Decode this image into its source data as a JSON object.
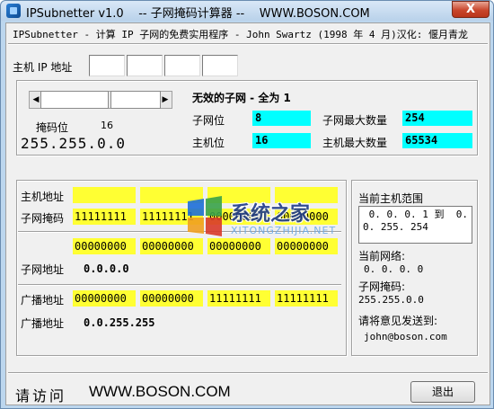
{
  "window": {
    "title": "IPSubnetter v1.0    -- 子网掩码计算器 --    WWW.BOSON.COM",
    "close_label": "X"
  },
  "header": {
    "subtitle": "IPSubnetter - 计算 IP 子网的免费实用程序 - John Swartz (1998 年 4 月)汉化: 偃月青龙"
  },
  "host_ip": {
    "label": "主机 IP 地址",
    "octets": [
      "",
      "",
      "",
      ""
    ]
  },
  "mask": {
    "bits_label": "掩码位",
    "bits_value": "16",
    "dotted": "255.255.0.0"
  },
  "stats": {
    "invalid_text": "无效的子网 - 全为 1",
    "subnet_bits_label": "子网位",
    "subnet_bits_value": "8",
    "max_subnets_label": "子网最大数量",
    "max_subnets_value": "254",
    "host_bits_label": "主机位",
    "host_bits_value": "16",
    "max_hosts_label": "主机最大数量",
    "max_hosts_value": "65534"
  },
  "binary": {
    "host_addr_label": "主机地址",
    "host_addr_bits": [
      "",
      "",
      "",
      ""
    ],
    "subnet_mask_label": "子网掩码",
    "subnet_mask_bits": [
      "11111111",
      "11111111",
      "00000000",
      "00000000"
    ],
    "subnet_addr_bits": [
      "00000000",
      "00000000",
      "00000000",
      "00000000"
    ],
    "subnet_addr_label": "子网地址",
    "subnet_addr_value": "0.0.0.0",
    "broadcast_bits_label": "广播地址",
    "broadcast_bits": [
      "00000000",
      "00000000",
      "11111111",
      "11111111"
    ],
    "broadcast_label": "广播地址",
    "broadcast_value": "0.0.255.255"
  },
  "right_panel": {
    "range_title": "当前主机范围",
    "range_text": " 0. 0. 0. 1 到  0.\n0. 255. 254",
    "current_network_label": "当前网络:",
    "current_network_value": "0. 0. 0. 0",
    "subnet_mask_label": "子网掩码:",
    "subnet_mask_value": "255.255.0.0",
    "feedback_label": "请将意见发送到:",
    "feedback_email": "john@boson.com"
  },
  "footer": {
    "visit_label": "请访问",
    "url": "WWW.BOSON.COM",
    "exit_label": "退出"
  },
  "watermark": {
    "text": "系统之家",
    "subtext": "XITONGZHIJIA.NET"
  },
  "colors": {
    "highlight_yellow": "#ffff33",
    "highlight_cyan": "#00ffff"
  }
}
